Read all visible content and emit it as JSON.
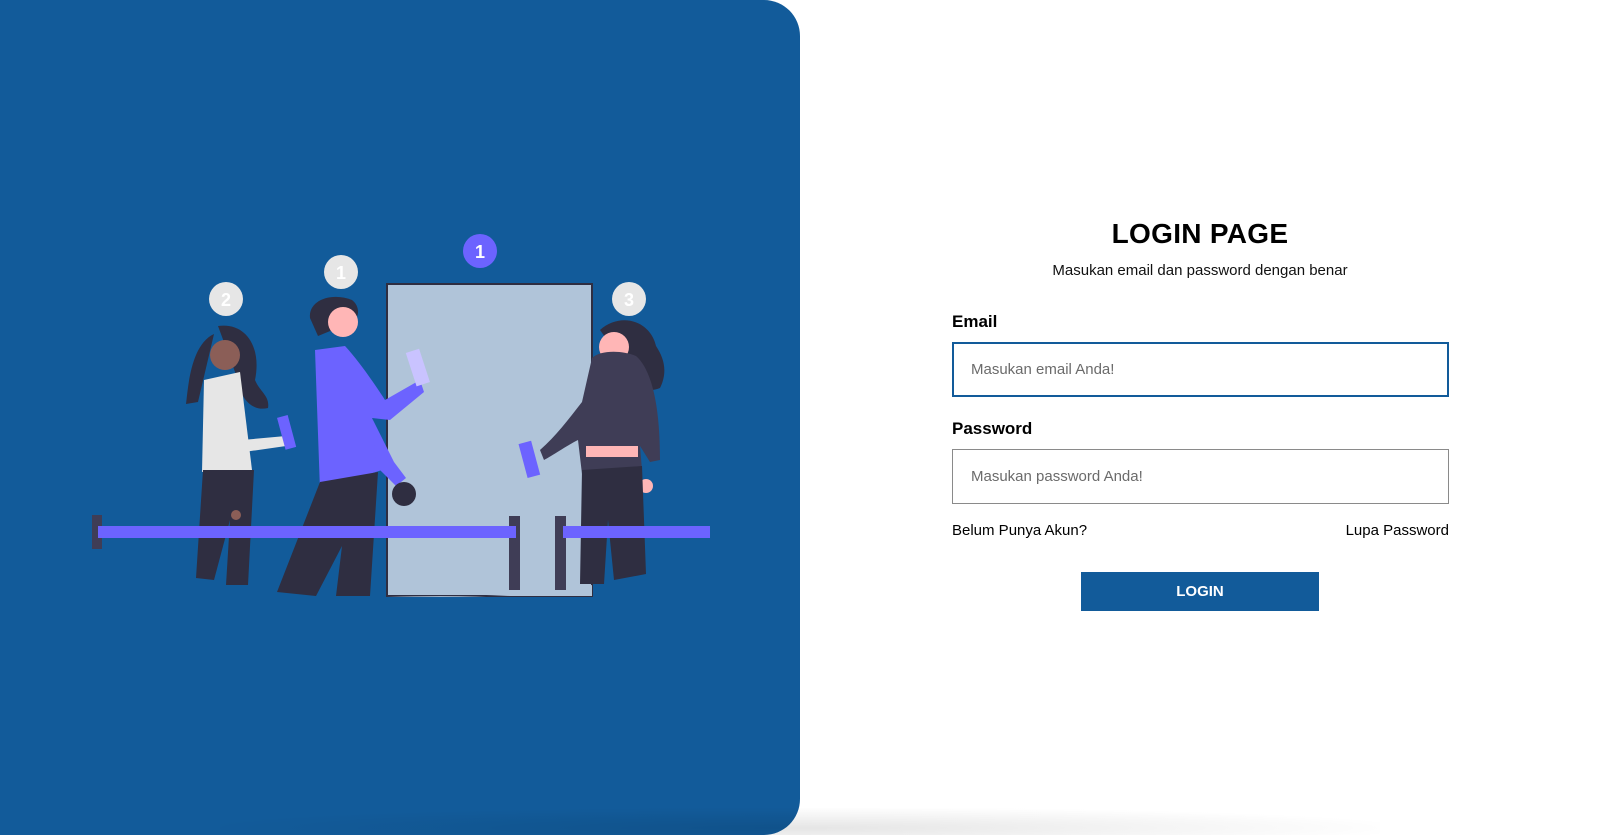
{
  "colors": {
    "brand_blue": "#125b9a",
    "accent_purple": "#6c63ff",
    "background": "#ffffff"
  },
  "illustration": {
    "name": "queue-illustration",
    "badges": [
      "2",
      "1",
      "1",
      "3"
    ]
  },
  "form": {
    "title": "LOGIN PAGE",
    "subtitle": "Masukan email dan password dengan benar",
    "email": {
      "label": "Email",
      "placeholder": "Masukan email Anda!",
      "value": ""
    },
    "password": {
      "label": "Password",
      "placeholder": "Masukan password Anda!",
      "value": ""
    },
    "register_link": "Belum Punya Akun?",
    "forgot_link": "Lupa Password",
    "submit_label": "LOGIN"
  }
}
